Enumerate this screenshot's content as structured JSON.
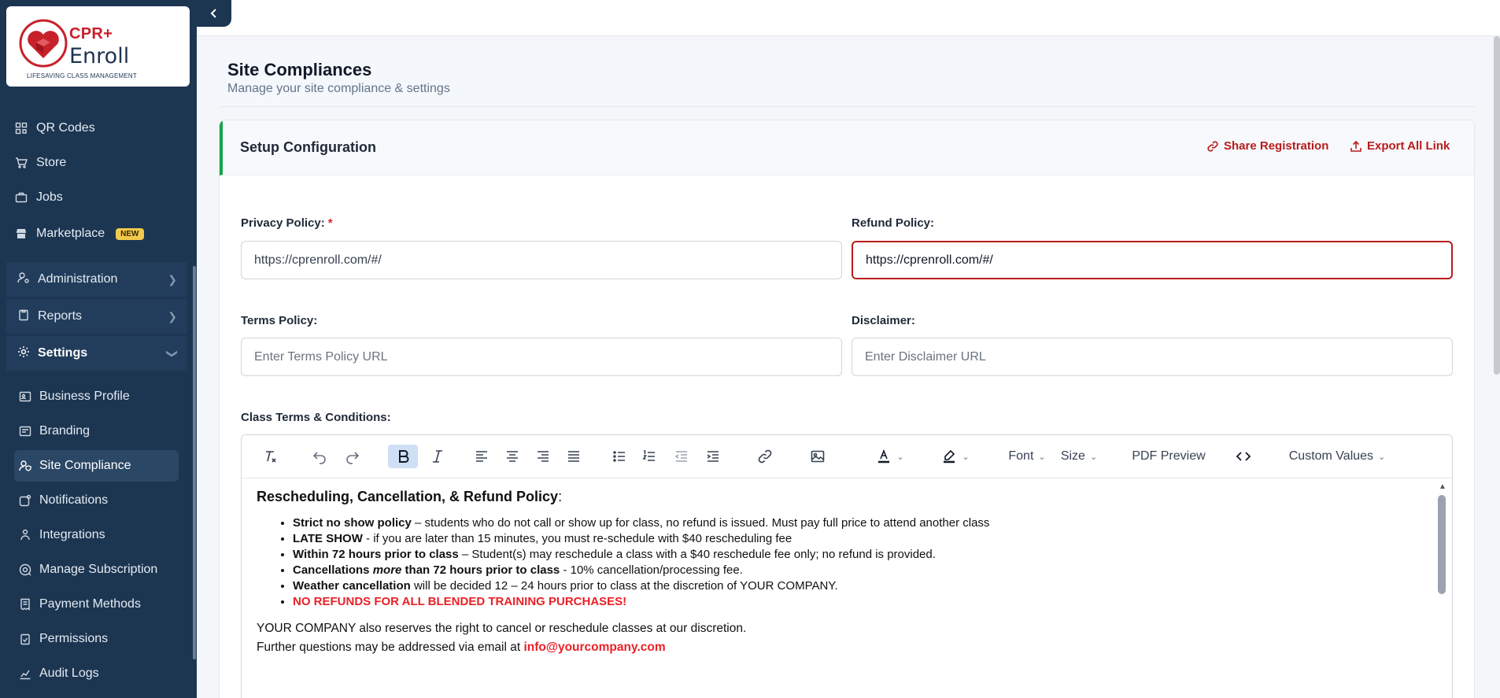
{
  "logo": {
    "brand_line1": "CPR+",
    "brand_line2": "Enroll",
    "tagline": "LIFESAVING CLASS MANAGEMENT"
  },
  "sidebar": {
    "top_items": [
      {
        "label": "QR Codes",
        "icon": "qr-code-icon"
      },
      {
        "label": "Store",
        "icon": "cart-icon"
      },
      {
        "label": "Jobs",
        "icon": "briefcase-icon"
      },
      {
        "label": "Marketplace",
        "icon": "store-icon",
        "badge": "NEW"
      }
    ],
    "groups": [
      {
        "label": "Administration",
        "icon": "user-gear-icon"
      },
      {
        "label": "Reports",
        "icon": "clipboard-icon"
      },
      {
        "label": "Settings",
        "icon": "gear-icon"
      }
    ],
    "settings_items": [
      {
        "label": "Business Profile"
      },
      {
        "label": "Branding"
      },
      {
        "label": "Site Compliance"
      },
      {
        "label": "Notifications"
      },
      {
        "label": "Integrations"
      },
      {
        "label": "Manage Subscription"
      },
      {
        "label": "Payment Methods"
      },
      {
        "label": "Permissions"
      },
      {
        "label": "Audit Logs"
      }
    ]
  },
  "page": {
    "title": "Site Compliances",
    "subtitle": "Manage your site compliance & settings"
  },
  "card": {
    "title": "Setup Configuration",
    "share_label": "Share Registration",
    "export_label": "Export All Link"
  },
  "form": {
    "privacy": {
      "label": "Privacy Policy:",
      "required_mark": "*",
      "value": "https://cprenroll.com/#/"
    },
    "refund": {
      "label": "Refund Policy:",
      "value": "https://cprenroll.com/#/"
    },
    "terms": {
      "label": "Terms Policy:",
      "placeholder": "Enter Terms Policy URL"
    },
    "disclaimer": {
      "label": "Disclaimer:",
      "placeholder": "Enter Disclaimer URL"
    },
    "class_terms_label": "Class Terms & Conditions:"
  },
  "editor_toolbar": {
    "font_label": "Font",
    "size_label": "Size",
    "pdf_preview_label": "PDF Preview",
    "custom_values_label": "Custom Values"
  },
  "editor_content": {
    "heading_bold": "Rescheduling, Cancellation, & Refund Policy",
    "heading_colon": ":",
    "bullets": [
      {
        "bold": "Strict no show policy",
        "rest": " – students who do not call or show up for class, no refund is issued. Must pay full price to attend another class"
      },
      {
        "bold": "LATE SHOW",
        "rest": " - if you are later than 15 minutes, you must re-schedule with $40 rescheduling fee"
      },
      {
        "bold": "Within 72 hours prior to class",
        "rest": " – Student(s) may reschedule a class with a $40 reschedule fee only; no refund is provided."
      },
      {
        "bold_a": "Cancellations ",
        "bold_italic": "more",
        "bold_b": " than 72 hours prior to class",
        "rest": " - 10% cancellation/processing fee."
      },
      {
        "bold": "Weather cancellation",
        "rest": " will be decided 12 – 24 hours prior to class at the discretion of YOUR COMPANY."
      },
      {
        "red": "NO REFUNDS FOR ALL BLENDED TRAINING PURCHASES!"
      }
    ],
    "para1": "YOUR COMPANY also reserves the right to cancel or reschedule classes at our discretion.",
    "para2_text": "Further questions may be addressed via email at ",
    "para2_email": "info@yourcompany.com"
  },
  "colors": {
    "sidebar": "#1c3551",
    "accent_red": "#b91c1c",
    "accent_green": "#16a34a"
  }
}
